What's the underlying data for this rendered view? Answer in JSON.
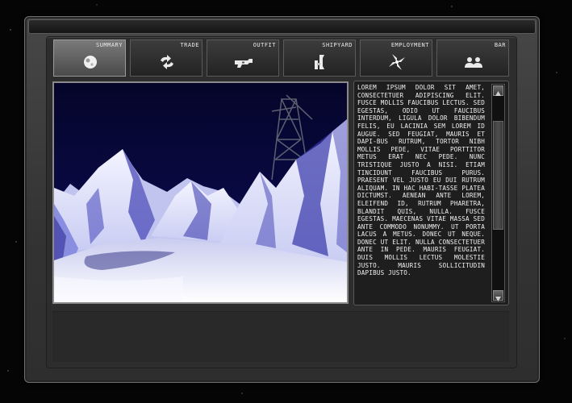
{
  "tabs": [
    {
      "label": "SUMMARY",
      "icon": "planet-icon",
      "active": true
    },
    {
      "label": "TRADE",
      "icon": "trade-arrows-icon",
      "active": false
    },
    {
      "label": "OUTFIT",
      "icon": "outfit-gun-icon",
      "active": false
    },
    {
      "label": "SHIPYARD",
      "icon": "shipyard-ship-icon",
      "active": false
    },
    {
      "label": "EMPLOYMENT",
      "icon": "employment-spiral-icon",
      "active": false
    },
    {
      "label": "BAR",
      "icon": "bar-people-icon",
      "active": false
    }
  ],
  "description": "Lorem ipsum dolor sit amet, consectetuer adipiscing elit. Fusce mollis faucibus lectus. Sed egestas, odio ut faucibus interdum, ligula dolor bibendum felis, eu lacinia sem lorem id augue. Sed feugiat, mauris et dapi-bus rutrum, tortor nibh mollis pede, vitae porttitor metus erat nec pede. Nunc tristique justo a nisi. Etiam tincidunt faucibus purus. Praesent vel justo eu dui rutrum aliquam. In hac habi-tasse platea dictumst. Aenean ante lorem, eleifend id, rutrum pharetra, blandit quis, nulla. Fusce egestas. Maecenas vitae massa sed ante commodo nonummy. Ut porta lacus a metus. Donec ut neque. Donec ut elit. Nulla consectetuer ante in pede. Mauris feugiat. Duis mollis lectus molestie justo. Mauris sollicitudin dapibus justo.",
  "colors": {
    "frame": "#3a3a3a",
    "sky": "#0a0a3a",
    "ice": "#d8dcff",
    "ice_shadow": "#3a3aa0",
    "text": "#f2f2f2"
  }
}
